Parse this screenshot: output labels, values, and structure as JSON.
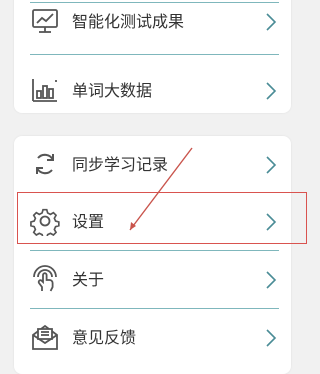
{
  "menu_group_1": {
    "items": [
      {
        "label": "智能化测试成果",
        "icon": "monitor-chart-icon"
      },
      {
        "label": "单词大数据",
        "icon": "bar-chart-icon"
      }
    ]
  },
  "menu_group_2": {
    "items": [
      {
        "label": "同步学习记录",
        "icon": "sync-icon"
      },
      {
        "label": "设置",
        "icon": "gear-icon"
      },
      {
        "label": "关于",
        "icon": "touch-icon"
      },
      {
        "label": "意见反馈",
        "icon": "mail-icon"
      }
    ]
  },
  "colors": {
    "divider": "#7fb7bc",
    "chevron": "#4a8c96",
    "icon": "#555555",
    "highlight": "#d9534f",
    "annotation_arrow": "#c9544c"
  }
}
